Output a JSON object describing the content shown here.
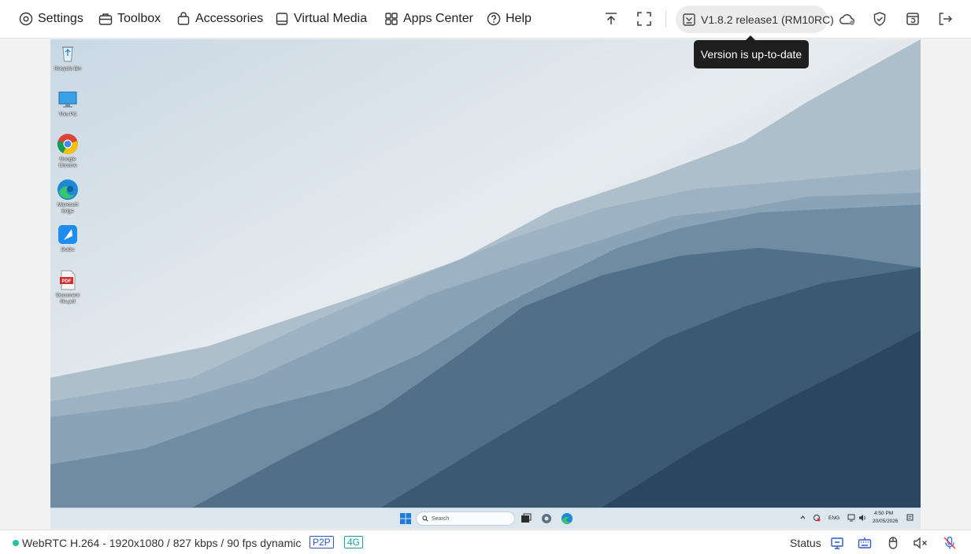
{
  "menu": {
    "settings": "Settings",
    "toolbox": "Toolbox",
    "accessories": "Accessories",
    "virtual_media": "Virtual Media",
    "apps_center": "Apps Center",
    "help": "Help"
  },
  "version": {
    "label": "V1.8.2 release1 (RM10RC)",
    "tooltip": "Version is up-to-date"
  },
  "desktop": {
    "icons": [
      {
        "label": "Recycle Bin",
        "icon": "recycle-bin-icon"
      },
      {
        "label": "This PC",
        "icon": "monitor-icon"
      },
      {
        "label": "Google\nChrome",
        "icon": "chrome-icon"
      },
      {
        "label": "Microsoft\nEdge",
        "icon": "edge-icon"
      },
      {
        "label": "DoDo",
        "icon": "feather-app-icon"
      },
      {
        "label": "Document\nfile.pdf",
        "icon": "pdf-icon"
      }
    ]
  },
  "taskbar": {
    "search_placeholder": "Search",
    "lang": "ENG",
    "time": "4:50 PM",
    "date": "20/05/2026"
  },
  "status": {
    "stream_info": "WebRTC H.264 - 1920x1080 /  827 kbps / 90 fps dynamic",
    "badge_p2p": "P2P",
    "badge_network": "4G",
    "status_label": "Status"
  },
  "colors": {
    "connection_dot": "#21c3a4",
    "p2p_badge": "#2f57c9",
    "network_badge": "#14a3a3",
    "mic_icon": "#3c6fe0"
  }
}
